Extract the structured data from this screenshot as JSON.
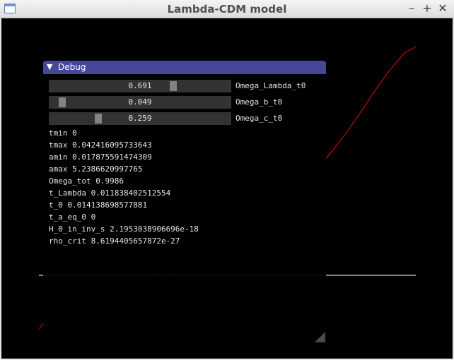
{
  "window": {
    "title": "Lambda-CDM model",
    "minimize": "–",
    "maximize": "+",
    "close": "✕"
  },
  "debug": {
    "title": "Debug",
    "collapse_glyph": "▼",
    "sliders": [
      {
        "value": "0.691",
        "label": "Omega_Lambda_t0",
        "fraction": 0.691
      },
      {
        "value": "0.049",
        "label": "Omega_b_t0",
        "fraction": 0.049
      },
      {
        "value": "0.259",
        "label": "Omega_c_t0",
        "fraction": 0.259
      }
    ],
    "info_lines": [
      "tmin 0",
      "tmax 0.042416095733643",
      "amin 0.017875591474309",
      "amax 5.2386620997765",
      "Omega_tot 0.9986",
      "t_Lambda 0.011838402512554",
      "t_0 0.014138698577881",
      "t_a_eq_0 0",
      "H_0_in_inv_s 2.1953038906696e-18",
      "rho_crit 8.6194405657872e-27"
    ]
  },
  "colors": {
    "curve": "#e01010",
    "axis": "#ffffff",
    "panel_header": "#474799"
  },
  "icons": [
    "app-window-icon",
    "minimize-icon",
    "maximize-icon",
    "close-icon",
    "collapse-arrow-icon",
    "resize-grip-icon"
  ]
}
